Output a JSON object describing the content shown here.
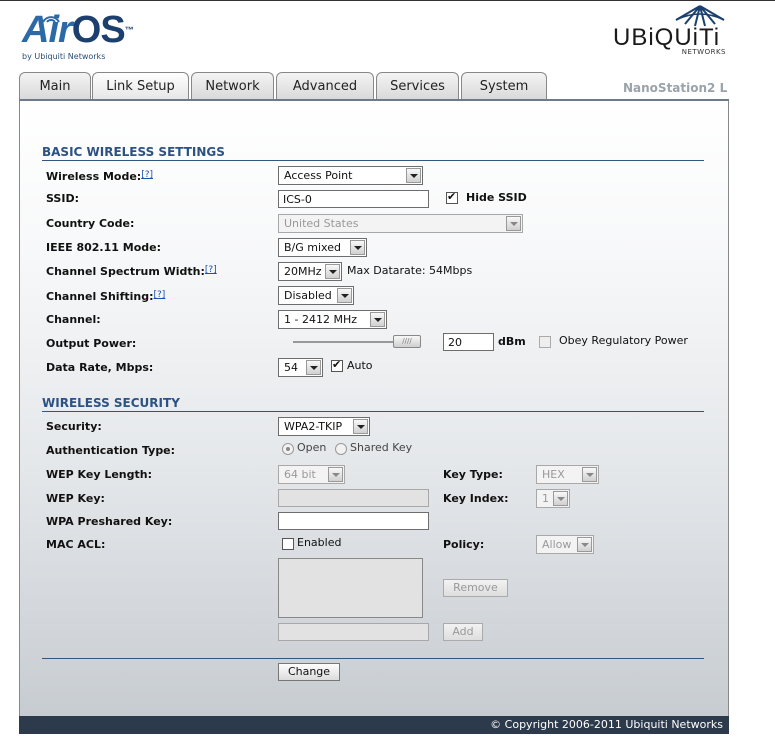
{
  "header": {
    "airos_brand_a": "Air",
    "airos_brand_b": "OS",
    "airos_tm": "™",
    "airos_sub": "by Ubiquiti Networks",
    "ubnt_name": "UBiQUiTi",
    "ubnt_sub": "NETWORKS"
  },
  "tabs": [
    {
      "label": "Main"
    },
    {
      "label": "Link Setup"
    },
    {
      "label": "Network"
    },
    {
      "label": "Advanced"
    },
    {
      "label": "Services"
    },
    {
      "label": "System"
    }
  ],
  "device_name": "NanoStation2 L",
  "basic": {
    "title": "BASIC WIRELESS SETTINGS",
    "help_marker": "[?]",
    "wireless_mode": {
      "label": "Wireless Mode:",
      "value": "Access Point"
    },
    "ssid": {
      "label": "SSID:",
      "value": "ICS-0",
      "hide_label": "Hide SSID",
      "hide_checked": true
    },
    "country_code": {
      "label": "Country Code:",
      "value": "United States"
    },
    "ieee_mode": {
      "label": "IEEE 802.11 Mode:",
      "value": "B/G mixed"
    },
    "channel_width": {
      "label": "Channel Spectrum Width:",
      "value": "20MHz",
      "max_datarate": "Max Datarate: 54Mbps"
    },
    "channel_shifting": {
      "label": "Channel Shifting:",
      "value": "Disabled"
    },
    "channel": {
      "label": "Channel:",
      "value": "1 - 2412 MHz"
    },
    "output_power": {
      "label": "Output Power:",
      "value": "20",
      "unit": "dBm",
      "obey_label": "Obey Regulatory Power",
      "obey_checked": false,
      "slider_level": 0.78
    },
    "data_rate": {
      "label": "Data Rate, Mbps:",
      "value": "54",
      "auto_label": "Auto",
      "auto_checked": true
    }
  },
  "security": {
    "title": "WIRELESS SECURITY",
    "security": {
      "label": "Security:",
      "value": "WPA2-TKIP"
    },
    "auth_type": {
      "label": "Authentication Type:",
      "open_label": "Open",
      "shared_label": "Shared Key",
      "selected": "Open"
    },
    "wep_key_length": {
      "label": "WEP Key Length:",
      "value": "64 bit"
    },
    "key_type": {
      "label": "Key Type:",
      "value": "HEX"
    },
    "wep_key": {
      "label": "WEP Key:",
      "value": ""
    },
    "key_index": {
      "label": "Key Index:",
      "value": "1"
    },
    "wpa_key": {
      "label": "WPA Preshared Key:",
      "value": ""
    },
    "mac_acl": {
      "label": "MAC ACL:",
      "enabled_label": "Enabled",
      "enabled_checked": false
    },
    "policy": {
      "label": "Policy:",
      "value": "Allow"
    },
    "remove_label": "Remove",
    "add_label": "Add"
  },
  "change_label": "Change",
  "footer": "© Copyright 2006-2011 Ubiquiti Networks"
}
